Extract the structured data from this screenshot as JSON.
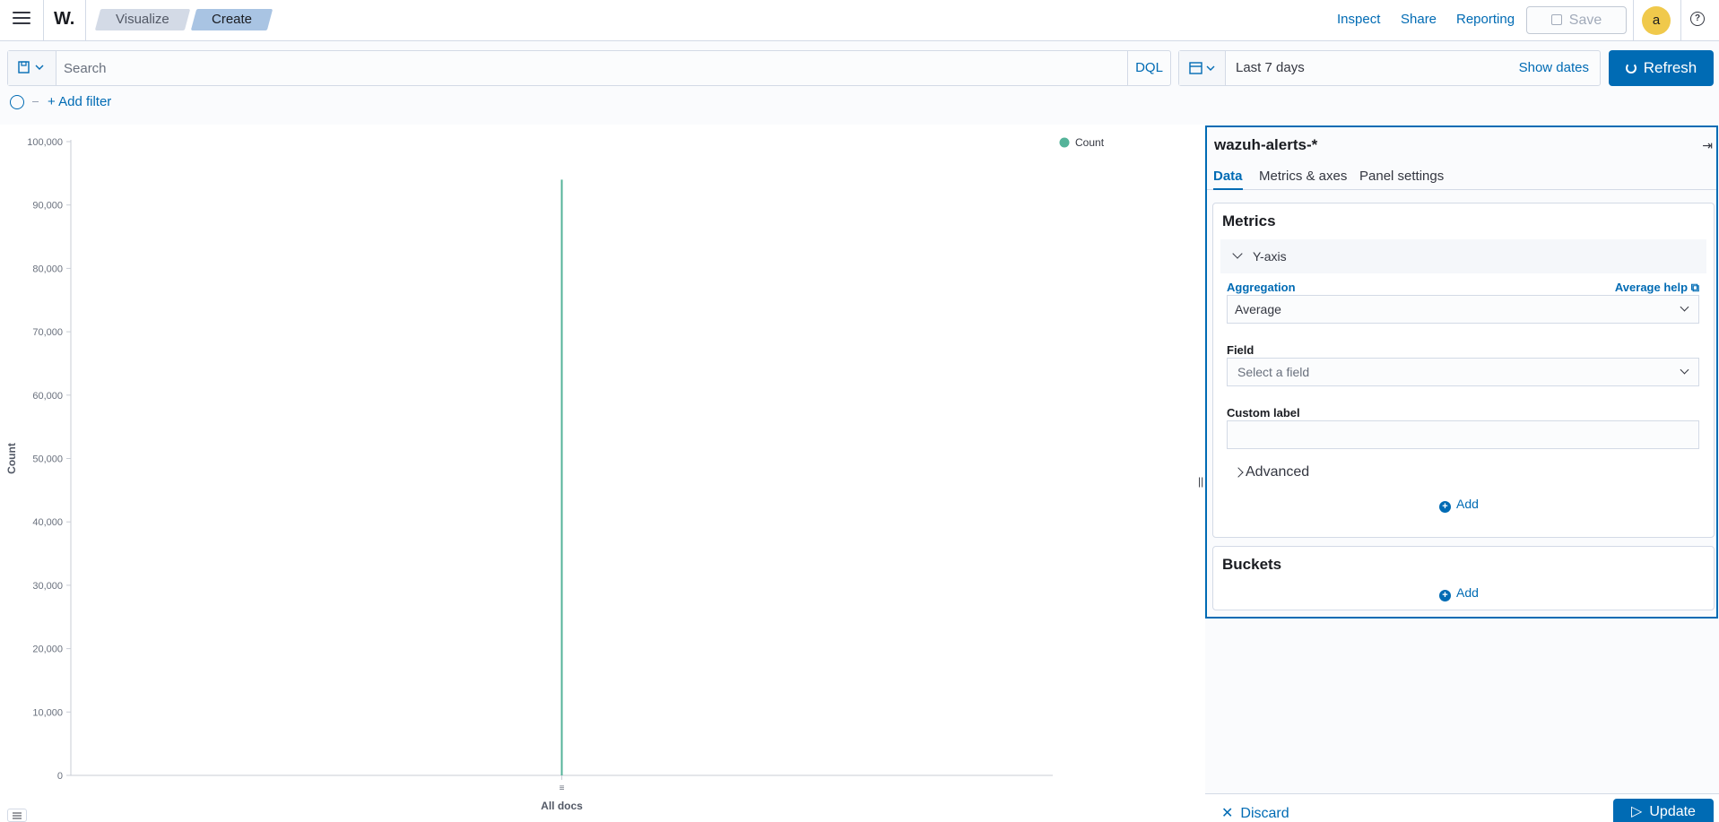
{
  "header": {
    "logo": "W.",
    "breadcrumbs": [
      "Visualize",
      "Create"
    ],
    "links": {
      "inspect": "Inspect",
      "share": "Share",
      "reporting": "Reporting"
    },
    "save_label": "Save",
    "avatar_initial": "a",
    "help": "?"
  },
  "query": {
    "search_placeholder": "Search",
    "language": "DQL",
    "time_range": "Last 7 days",
    "show_dates": "Show dates",
    "refresh_label": "Refresh",
    "add_filter": "+ Add filter"
  },
  "chart_data": {
    "type": "bar",
    "categories": [
      "All docs"
    ],
    "series": [
      {
        "name": "Count",
        "values": [
          94000
        ]
      }
    ],
    "xlabel": "All docs",
    "ylabel": "Count",
    "ylim": [
      0,
      100000
    ],
    "yticks": [
      0,
      10000,
      20000,
      30000,
      40000,
      50000,
      60000,
      70000,
      80000,
      90000,
      100000
    ],
    "ytick_labels": [
      "0",
      "10,000",
      "20,000",
      "30,000",
      "40,000",
      "50,000",
      "60,000",
      "70,000",
      "80,000",
      "90,000",
      "100,000"
    ],
    "legend": "top-right",
    "legend_label": "Count",
    "series_color": "#54b399",
    "grid": false
  },
  "editor": {
    "index_pattern": "wazuh-alerts-*",
    "tabs": [
      "Data",
      "Metrics & axes",
      "Panel settings"
    ],
    "metrics": {
      "title": "Metrics",
      "yaxis_label": "Y-axis",
      "aggregation_label": "Aggregation",
      "aggregation_help": "Average help",
      "aggregation_value": "Average",
      "field_label": "Field",
      "field_placeholder": "Select a field",
      "custom_label": "Custom label",
      "custom_label_value": "",
      "advanced": "Advanced",
      "add": "Add"
    },
    "buckets": {
      "title": "Buckets",
      "add": "Add"
    },
    "discard": "Discard",
    "update": "Update"
  },
  "colors": {
    "accent": "#006bb4",
    "series": "#54b399",
    "avatar": "#f0c94b"
  }
}
